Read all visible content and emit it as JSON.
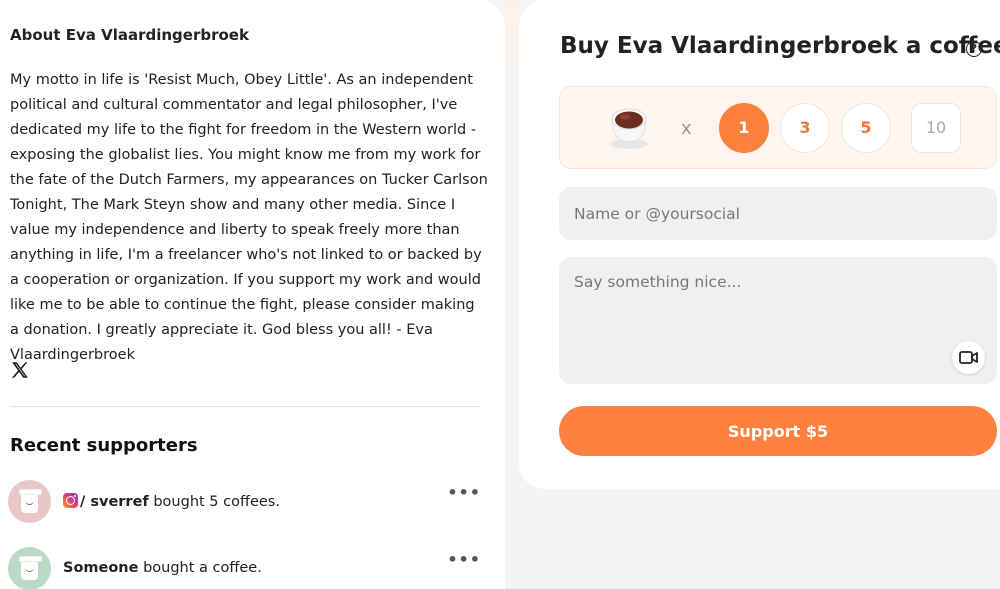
{
  "about": {
    "title": "About Eva Vlaardingerbroek",
    "body": "My motto in life is 'Resist Much, Obey Little'. As an independent political and cultural commentator and legal philosopher, I've dedicated my life to the fight for freedom in the Western world - exposing the globalist lies. You might know me from my work for the fate of the Dutch Farmers, my appearances on Tucker Carlson Tonight, The Mark Steyn show and many other media. Since I value my independence and liberty to speak freely more than anything in life, I'm a freelancer who's not linked to or backed by a cooperation or organization. If you support my work and would like me to be able to continue the fight, please consider making a donation. I greatly appreciate it. God bless you all! - Eva Vlaardingerbroek",
    "social_icon": "x-twitter-icon"
  },
  "supporters": {
    "title": "Recent supporters",
    "items": [
      {
        "platform_icon": "instagram-icon",
        "prefix": "/ ",
        "name": "sverref",
        "action": " bought 5 coffees.",
        "avatar_color": "#e9c7c7",
        "more": "•••"
      },
      {
        "platform_icon": "",
        "prefix": "",
        "name": "Someone",
        "action": " bought a coffee.",
        "avatar_color": "#bcd8c8",
        "more": "•••"
      }
    ]
  },
  "buy": {
    "title": "Buy Eva Vlaardingerbroek a coffee",
    "help_icon": "question-circle-icon",
    "multiplier": "x",
    "quantities": [
      "1",
      "3",
      "5"
    ],
    "selected_quantity": "1",
    "custom_quantity_placeholder": "10",
    "name_placeholder": "Name or @yoursocial",
    "message_placeholder": "Say something nice...",
    "video_icon": "video-camera-icon",
    "support_label": "Support $5"
  },
  "colors": {
    "accent": "#ff813f",
    "accent_text": "#f47832",
    "qty_box_bg": "#fff6f0",
    "input_bg": "#f0f0f0"
  }
}
